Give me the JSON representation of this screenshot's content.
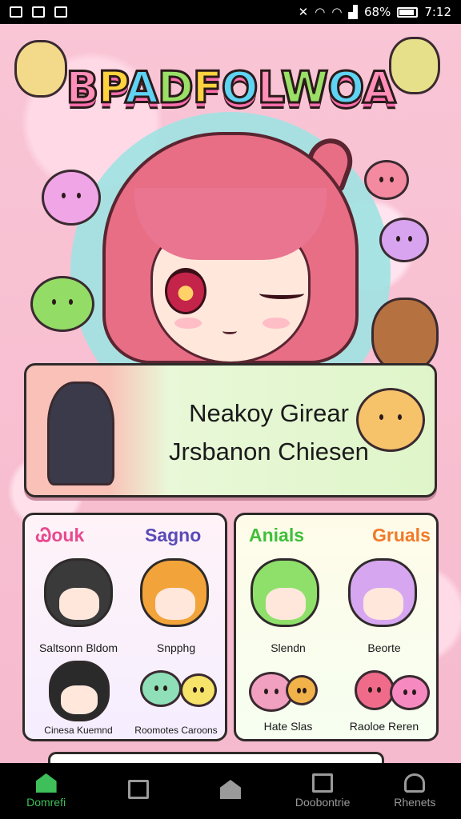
{
  "status_bar": {
    "battery": "68%",
    "time": "7:12"
  },
  "game": {
    "title": "BPADFOLWOA"
  },
  "banner": {
    "line1": "Neakoy Girear",
    "line2": "Jrsbanon Chiesen"
  },
  "panels": [
    {
      "headers": [
        "Ꮚouk",
        "Sagno"
      ],
      "header_colors": [
        "#e84a8f",
        "#5a4bb8"
      ],
      "cells": [
        {
          "label": "Saltsonn Bldom",
          "hair": "#3a3a3a"
        },
        {
          "label": "Snpphg",
          "hair": "#f2a43a"
        },
        {
          "label": "Cinesa Kuemnd",
          "hair": "#2a2a2a"
        },
        {
          "label": "Roomotes Caroons",
          "hair": "#8fe0b8"
        }
      ]
    },
    {
      "headers": [
        "Anials",
        "Gruals"
      ],
      "header_colors": [
        "#3fbf3a",
        "#f07a2a"
      ],
      "cells": [
        {
          "label": "Slendn",
          "hair": "#8fe06a"
        },
        {
          "label": "Beorte",
          "hair": "#d7a6f0"
        },
        {
          "label": "Hate Slas",
          "hair": "#f2a0c0"
        },
        {
          "label": "Raoloe Reren",
          "hair": "#f06b8a"
        }
      ]
    }
  ],
  "nav": [
    {
      "label": "Domrefi",
      "icon": "home-icon",
      "active": true
    },
    {
      "label": "",
      "icon": "square-icon",
      "active": false
    },
    {
      "label": "",
      "icon": "house-outline-icon",
      "active": false
    },
    {
      "label": "Doobontrie",
      "icon": "document-icon",
      "active": false
    },
    {
      "label": "Rhenets",
      "icon": "person-icon",
      "active": false
    }
  ],
  "colors": {
    "accent_active": "#3fbf5a",
    "background_pink": "#f7c4d4"
  }
}
